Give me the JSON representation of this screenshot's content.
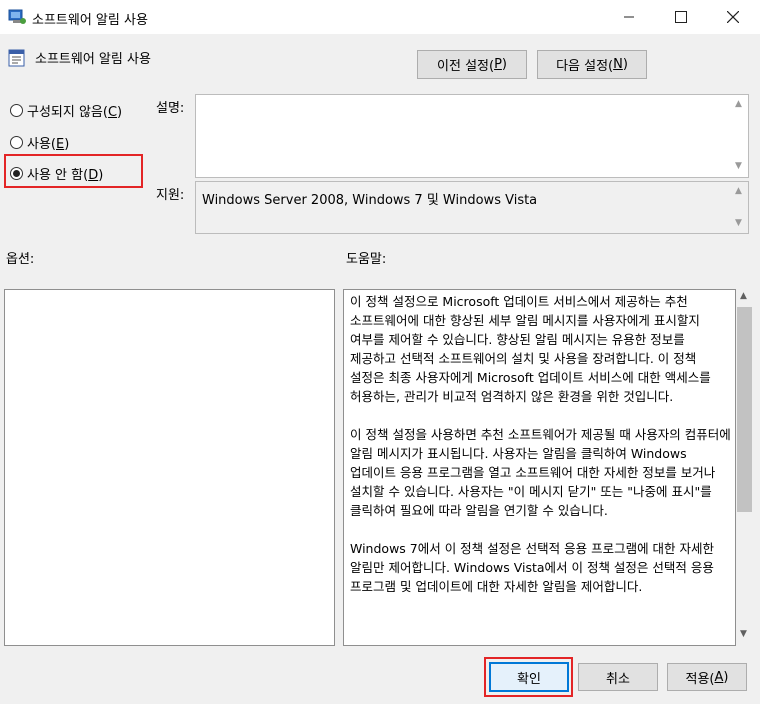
{
  "window": {
    "title": "소프트웨어 알림 사용"
  },
  "header": {
    "policy_title": "소프트웨어 알림 사용",
    "prev_button_text": "이전 설정(",
    "prev_button_key": "P",
    "next_button_text": "다음 설정(",
    "next_button_key": "N",
    "button_close_paren": ")"
  },
  "state": {
    "options": [
      {
        "label": "구성되지 않음(",
        "key": "C",
        "checked": false
      },
      {
        "label": "사용(",
        "key": "E",
        "checked": false
      },
      {
        "label": "사용 안 함(",
        "key": "D",
        "checked": true
      }
    ]
  },
  "labels": {
    "comment": "설명:",
    "supported": "지원:",
    "options": "옵션:",
    "help": "도움말:"
  },
  "comment_value": "",
  "supported_on": "Windows Server 2008, Windows 7 및 Windows Vista",
  "help_paragraphs": [
    "이 정책 설정으로 Microsoft 업데이트 서비스에서 제공하는 추천 소프트웨어에 대한 향상된 세부 알림 메시지를 사용자에게 표시할지 여부를 제어할 수 있습니다. 향상된 알림 메시지는 유용한 정보를 제공하고 선택적 소프트웨어의 설치 및 사용을 장려합니다. 이 정책 설정은 최종 사용자에게 Microsoft 업데이트 서비스에 대한 액세스를 허용하는, 관리가 비교적 엄격하지 않은 환경을 위한 것입니다.",
    "이 정책 설정을 사용하면 추천 소프트웨어가 제공될 때 사용자의 컴퓨터에 알림 메시지가 표시됩니다. 사용자는 알림을 클릭하여 Windows 업데이트 응용 프로그램을 열고 소프트웨어 대한 자세한 정보를 보거나 설치할 수 있습니다. 사용자는 \"이 메시지 닫기\" 또는 \"나중에 표시\"를 클릭하여 필요에 따라 알림을 연기할 수 있습니다.",
    "Windows 7에서 이 정책 설정은 선택적 응용 프로그램에 대한 자세한 알림만 제어합니다. Windows Vista에서 이 정책 설정은 선택적 응용 프로그램 및 업데이트에 대한 자세한 알림을 제어합니다."
  ],
  "footer": {
    "ok": "확인",
    "cancel": "취소",
    "apply_text": "적용(",
    "apply_key": "A",
    "close_paren": ")"
  },
  "colors": {
    "highlight": "#e32526",
    "focus_border": "#0078d7"
  }
}
